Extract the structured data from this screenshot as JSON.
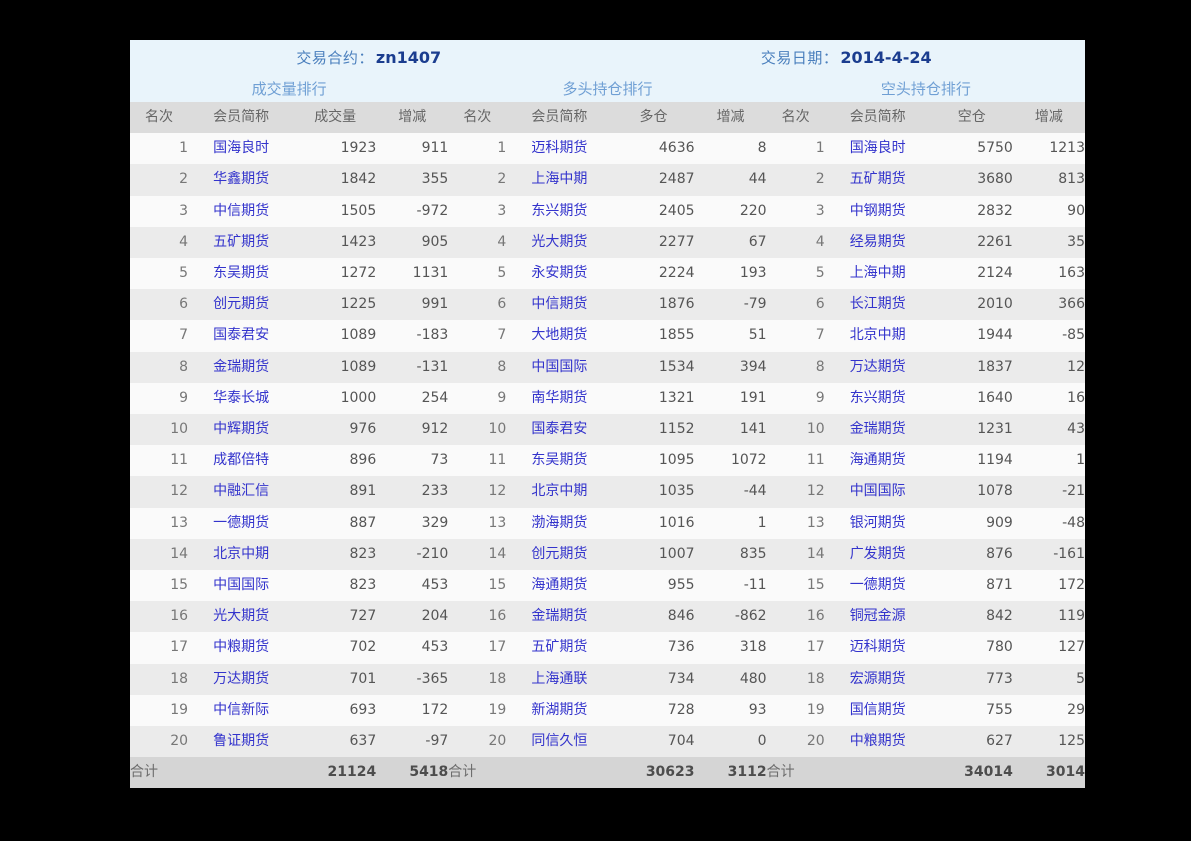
{
  "banner": {
    "contract_label": "交易合约：",
    "contract_value": "zn1407",
    "date_label": "交易日期：",
    "date_value": "2014-4-24",
    "sections": [
      "成交量排行",
      "多头持仓排行",
      "空头持仓排行"
    ]
  },
  "colors": {
    "banner_bg": "#e9f4fb",
    "banner_label": "#4a7fbd",
    "banner_value": "#1b3d8f",
    "section_title": "#6f9fd4",
    "header_bg": "#dcdcdc",
    "row_odd": "#fafafa",
    "row_even": "#ebebeb",
    "footer_bg": "#d5d5d5",
    "member_name": "#3333cc",
    "number": "#555555",
    "page_bg": "#000000"
  },
  "headers": [
    "名次",
    "会员简称",
    "成交量",
    "增减",
    "名次",
    "会员简称",
    "多仓",
    "增减",
    "名次",
    "会员简称",
    "空仓",
    "增减"
  ],
  "rows": [
    {
      "r1": "1",
      "n1": "国海良时",
      "v1": "1923",
      "d1": "911",
      "r2": "1",
      "n2": "迈科期货",
      "v2": "4636",
      "d2": "8",
      "r3": "1",
      "n3": "国海良时",
      "v3": "5750",
      "d3": "1213"
    },
    {
      "r1": "2",
      "n1": "华鑫期货",
      "v1": "1842",
      "d1": "355",
      "r2": "2",
      "n2": "上海中期",
      "v2": "2487",
      "d2": "44",
      "r3": "2",
      "n3": "五矿期货",
      "v3": "3680",
      "d3": "813"
    },
    {
      "r1": "3",
      "n1": "中信期货",
      "v1": "1505",
      "d1": "-972",
      "r2": "3",
      "n2": "东兴期货",
      "v2": "2405",
      "d2": "220",
      "r3": "3",
      "n3": "中钢期货",
      "v3": "2832",
      "d3": "90"
    },
    {
      "r1": "4",
      "n1": "五矿期货",
      "v1": "1423",
      "d1": "905",
      "r2": "4",
      "n2": "光大期货",
      "v2": "2277",
      "d2": "67",
      "r3": "4",
      "n3": "经易期货",
      "v3": "2261",
      "d3": "35"
    },
    {
      "r1": "5",
      "n1": "东吴期货",
      "v1": "1272",
      "d1": "1131",
      "r2": "5",
      "n2": "永安期货",
      "v2": "2224",
      "d2": "193",
      "r3": "5",
      "n3": "上海中期",
      "v3": "2124",
      "d3": "163"
    },
    {
      "r1": "6",
      "n1": "创元期货",
      "v1": "1225",
      "d1": "991",
      "r2": "6",
      "n2": "中信期货",
      "v2": "1876",
      "d2": "-79",
      "r3": "6",
      "n3": "长江期货",
      "v3": "2010",
      "d3": "366"
    },
    {
      "r1": "7",
      "n1": "国泰君安",
      "v1": "1089",
      "d1": "-183",
      "r2": "7",
      "n2": "大地期货",
      "v2": "1855",
      "d2": "51",
      "r3": "7",
      "n3": "北京中期",
      "v3": "1944",
      "d3": "-85"
    },
    {
      "r1": "8",
      "n1": "金瑞期货",
      "v1": "1089",
      "d1": "-131",
      "r2": "8",
      "n2": "中国国际",
      "v2": "1534",
      "d2": "394",
      "r3": "8",
      "n3": "万达期货",
      "v3": "1837",
      "d3": "12"
    },
    {
      "r1": "9",
      "n1": "华泰长城",
      "v1": "1000",
      "d1": "254",
      "r2": "9",
      "n2": "南华期货",
      "v2": "1321",
      "d2": "191",
      "r3": "9",
      "n3": "东兴期货",
      "v3": "1640",
      "d3": "16"
    },
    {
      "r1": "10",
      "n1": "中辉期货",
      "v1": "976",
      "d1": "912",
      "r2": "10",
      "n2": "国泰君安",
      "v2": "1152",
      "d2": "141",
      "r3": "10",
      "n3": "金瑞期货",
      "v3": "1231",
      "d3": "43"
    },
    {
      "r1": "11",
      "n1": "成都倍特",
      "v1": "896",
      "d1": "73",
      "r2": "11",
      "n2": "东吴期货",
      "v2": "1095",
      "d2": "1072",
      "r3": "11",
      "n3": "海通期货",
      "v3": "1194",
      "d3": "1"
    },
    {
      "r1": "12",
      "n1": "中融汇信",
      "v1": "891",
      "d1": "233",
      "r2": "12",
      "n2": "北京中期",
      "v2": "1035",
      "d2": "-44",
      "r3": "12",
      "n3": "中国国际",
      "v3": "1078",
      "d3": "-21"
    },
    {
      "r1": "13",
      "n1": "一德期货",
      "v1": "887",
      "d1": "329",
      "r2": "13",
      "n2": "渤海期货",
      "v2": "1016",
      "d2": "1",
      "r3": "13",
      "n3": "银河期货",
      "v3": "909",
      "d3": "-48"
    },
    {
      "r1": "14",
      "n1": "北京中期",
      "v1": "823",
      "d1": "-210",
      "r2": "14",
      "n2": "创元期货",
      "v2": "1007",
      "d2": "835",
      "r3": "14",
      "n3": "广发期货",
      "v3": "876",
      "d3": "-161"
    },
    {
      "r1": "15",
      "n1": "中国国际",
      "v1": "823",
      "d1": "453",
      "r2": "15",
      "n2": "海通期货",
      "v2": "955",
      "d2": "-11",
      "r3": "15",
      "n3": "一德期货",
      "v3": "871",
      "d3": "172"
    },
    {
      "r1": "16",
      "n1": "光大期货",
      "v1": "727",
      "d1": "204",
      "r2": "16",
      "n2": "金瑞期货",
      "v2": "846",
      "d2": "-862",
      "r3": "16",
      "n3": "铜冠金源",
      "v3": "842",
      "d3": "119"
    },
    {
      "r1": "17",
      "n1": "中粮期货",
      "v1": "702",
      "d1": "453",
      "r2": "17",
      "n2": "五矿期货",
      "v2": "736",
      "d2": "318",
      "r3": "17",
      "n3": "迈科期货",
      "v3": "780",
      "d3": "127"
    },
    {
      "r1": "18",
      "n1": "万达期货",
      "v1": "701",
      "d1": "-365",
      "r2": "18",
      "n2": "上海通联",
      "v2": "734",
      "d2": "480",
      "r3": "18",
      "n3": "宏源期货",
      "v3": "773",
      "d3": "5"
    },
    {
      "r1": "19",
      "n1": "中信新际",
      "v1": "693",
      "d1": "172",
      "r2": "19",
      "n2": "新湖期货",
      "v2": "728",
      "d2": "93",
      "r3": "19",
      "n3": "国信期货",
      "v3": "755",
      "d3": "29"
    },
    {
      "r1": "20",
      "n1": "鲁证期货",
      "v1": "637",
      "d1": "-97",
      "r2": "20",
      "n2": "同信久恒",
      "v2": "704",
      "d2": "0",
      "r3": "20",
      "n3": "中粮期货",
      "v3": "627",
      "d3": "125"
    }
  ],
  "footer": {
    "label": "合计",
    "total_volume": "21124",
    "total_volume_delta": "5418",
    "total_long": "30623",
    "total_long_delta": "3112",
    "total_short": "34014",
    "total_short_delta": "3014"
  }
}
